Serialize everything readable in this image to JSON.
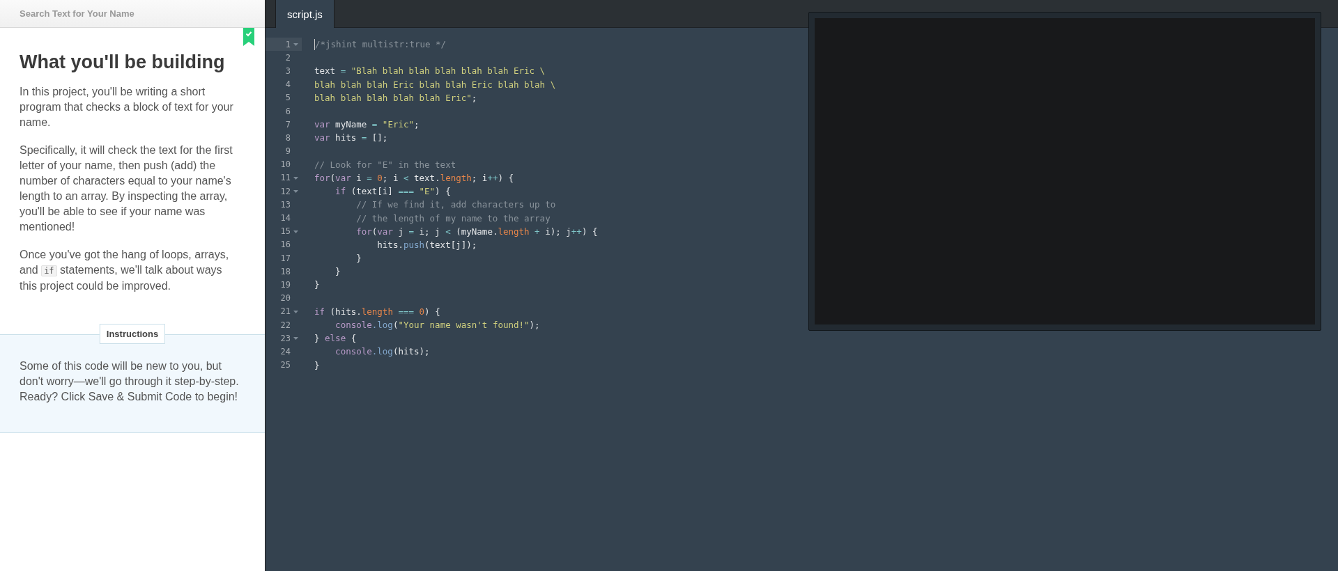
{
  "lesson": {
    "header": "Search Text for Your Name",
    "completed": true,
    "title": "What you'll be building",
    "paragraphs": [
      {
        "parts": [
          {
            "kind": "text",
            "text": "In this project, you'll be writing a short program that checks a block of text for your name."
          }
        ]
      },
      {
        "parts": [
          {
            "kind": "text",
            "text": "Specifically, it will check the text for the first letter of your name, then push (add) the number of characters equal to your name's length to an array. By inspecting the array, you'll be able to see if your name was mentioned!"
          }
        ]
      },
      {
        "parts": [
          {
            "kind": "text",
            "text": "Once you've got the hang of loops, arrays, and "
          },
          {
            "kind": "code",
            "text": "if"
          },
          {
            "kind": "text",
            "text": " statements, we'll talk about ways this project could be improved."
          }
        ]
      }
    ],
    "instructions": {
      "label": "Instructions",
      "text": "Some of this code will be new to you, but don't worry—we'll go through it step-by-step. Ready? Click Save & Submit Code to begin!"
    }
  },
  "editor": {
    "tabs": [
      {
        "label": "script.js",
        "selected": true
      }
    ],
    "lines": [
      {
        "number": "1",
        "foldable": true,
        "active": true,
        "tokens": [
          {
            "kind": "comment",
            "text": "/*jshint multistr:true */"
          }
        ]
      },
      {
        "number": "2",
        "foldable": false,
        "active": false
      },
      {
        "number": "3",
        "foldable": false,
        "active": false,
        "tokens": [
          {
            "kind": "plain",
            "text": "text "
          },
          {
            "kind": "op",
            "text": "="
          },
          {
            "kind": "string",
            "text": " \"Blah blah blah blah blah blah Eric \\"
          }
        ]
      },
      {
        "number": "4",
        "foldable": false,
        "active": false,
        "tokens": [
          {
            "kind": "string",
            "text": "blah blah blah Eric blah blah Eric blah blah \\"
          }
        ]
      },
      {
        "number": "5",
        "foldable": false,
        "active": false,
        "tokens": [
          {
            "kind": "string",
            "text": "blah blah blah blah blah Eric\""
          },
          {
            "kind": "plain",
            "text": ";"
          }
        ]
      },
      {
        "number": "6",
        "foldable": false,
        "active": false
      },
      {
        "number": "7",
        "foldable": false,
        "active": false,
        "tokens": [
          {
            "kind": "keyword",
            "text": "var"
          },
          {
            "kind": "plain",
            "text": " myName "
          },
          {
            "kind": "op",
            "text": "="
          },
          {
            "kind": "string",
            "text": " \"Eric\""
          },
          {
            "kind": "plain",
            "text": ";"
          }
        ]
      },
      {
        "number": "8",
        "foldable": false,
        "active": false,
        "tokens": [
          {
            "kind": "keyword",
            "text": "var"
          },
          {
            "kind": "plain",
            "text": " hits "
          },
          {
            "kind": "op",
            "text": "="
          },
          {
            "kind": "plain",
            "text": " [];"
          }
        ]
      },
      {
        "number": "9",
        "foldable": false,
        "active": false
      },
      {
        "number": "10",
        "foldable": false,
        "active": false,
        "tokens": [
          {
            "kind": "comment",
            "text": "// Look for \"E\" in the text"
          }
        ]
      },
      {
        "number": "11",
        "foldable": true,
        "active": false,
        "tokens": [
          {
            "kind": "keyword",
            "text": "for"
          },
          {
            "kind": "plain",
            "text": "("
          },
          {
            "kind": "keyword",
            "text": "var"
          },
          {
            "kind": "plain",
            "text": " i "
          },
          {
            "kind": "op",
            "text": "="
          },
          {
            "kind": "number",
            "text": " 0"
          },
          {
            "kind": "plain",
            "text": "; i "
          },
          {
            "kind": "op",
            "text": "<"
          },
          {
            "kind": "plain",
            "text": " text."
          },
          {
            "kind": "number",
            "text": "length"
          },
          {
            "kind": "plain",
            "text": "; i"
          },
          {
            "kind": "op",
            "text": "++"
          },
          {
            "kind": "plain",
            "text": ") {"
          }
        ]
      },
      {
        "number": "12",
        "foldable": true,
        "active": false,
        "tokens": [
          {
            "kind": "keyword",
            "text": "    if"
          },
          {
            "kind": "plain",
            "text": " (text[i] "
          },
          {
            "kind": "op",
            "text": "==="
          },
          {
            "kind": "string",
            "text": " \"E\""
          },
          {
            "kind": "plain",
            "text": ") {"
          }
        ]
      },
      {
        "number": "13",
        "foldable": false,
        "active": false,
        "tokens": [
          {
            "kind": "comment",
            "text": "        // If we find it, add characters up to"
          }
        ]
      },
      {
        "number": "14",
        "foldable": false,
        "active": false,
        "tokens": [
          {
            "kind": "comment",
            "text": "        // the length of my name to the array"
          }
        ]
      },
      {
        "number": "15",
        "foldable": true,
        "active": false,
        "tokens": [
          {
            "kind": "keyword",
            "text": "        for"
          },
          {
            "kind": "plain",
            "text": "("
          },
          {
            "kind": "keyword",
            "text": "var"
          },
          {
            "kind": "plain",
            "text": " j "
          },
          {
            "kind": "op",
            "text": "="
          },
          {
            "kind": "plain",
            "text": " i; j "
          },
          {
            "kind": "op",
            "text": "<"
          },
          {
            "kind": "plain",
            "text": " (myName."
          },
          {
            "kind": "number",
            "text": "length"
          },
          {
            "kind": "op",
            "text": " +"
          },
          {
            "kind": "plain",
            "text": " i); j"
          },
          {
            "kind": "op",
            "text": "++"
          },
          {
            "kind": "plain",
            "text": ") {"
          }
        ]
      },
      {
        "number": "16",
        "foldable": false,
        "active": false,
        "tokens": [
          {
            "kind": "plain",
            "text": "            hits."
          },
          {
            "kind": "method",
            "text": "push"
          },
          {
            "kind": "plain",
            "text": "(text[j]);"
          }
        ]
      },
      {
        "number": "17",
        "foldable": false,
        "active": false,
        "tokens": [
          {
            "kind": "plain",
            "text": "        }"
          }
        ]
      },
      {
        "number": "18",
        "foldable": false,
        "active": false,
        "tokens": [
          {
            "kind": "plain",
            "text": "    }"
          }
        ]
      },
      {
        "number": "19",
        "foldable": false,
        "active": false,
        "tokens": [
          {
            "kind": "plain",
            "text": "}"
          }
        ]
      },
      {
        "number": "20",
        "foldable": false,
        "active": false
      },
      {
        "number": "21",
        "foldable": true,
        "active": false,
        "tokens": [
          {
            "kind": "keyword",
            "text": "if"
          },
          {
            "kind": "plain",
            "text": " (hits."
          },
          {
            "kind": "number",
            "text": "length"
          },
          {
            "kind": "op",
            "text": " ==="
          },
          {
            "kind": "number",
            "text": " 0"
          },
          {
            "kind": "plain",
            "text": ") {"
          }
        ]
      },
      {
        "number": "22",
        "foldable": false,
        "active": false,
        "tokens": [
          {
            "kind": "builtin",
            "text": "    console"
          },
          {
            "kind": "method",
            "text": ".log"
          },
          {
            "kind": "plain",
            "text": "("
          },
          {
            "kind": "string",
            "text": "\"Your name wasn't found!\""
          },
          {
            "kind": "plain",
            "text": ");"
          }
        ]
      },
      {
        "number": "23",
        "foldable": true,
        "active": false,
        "tokens": [
          {
            "kind": "plain",
            "text": "} "
          },
          {
            "kind": "keyword",
            "text": "else"
          },
          {
            "kind": "plain",
            "text": " {"
          }
        ]
      },
      {
        "number": "24",
        "foldable": false,
        "active": false,
        "tokens": [
          {
            "kind": "builtin",
            "text": "    console"
          },
          {
            "kind": "method",
            "text": ".log"
          },
          {
            "kind": "plain",
            "text": "(hits);"
          }
        ]
      },
      {
        "number": "25",
        "foldable": false,
        "active": false,
        "tokens": [
          {
            "kind": "plain",
            "text": "}"
          }
        ]
      }
    ]
  }
}
